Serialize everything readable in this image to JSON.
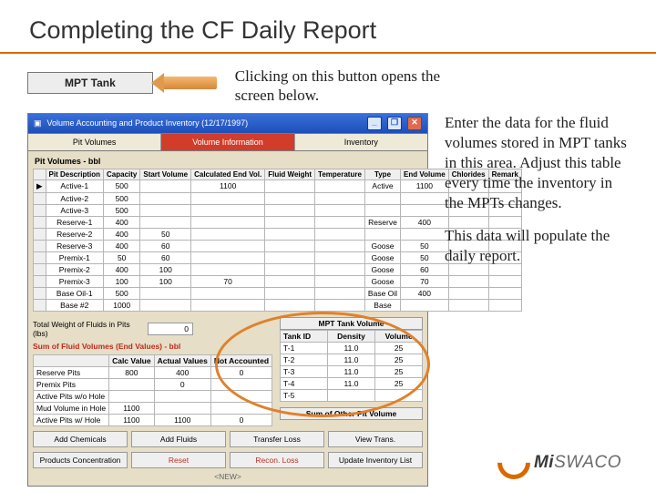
{
  "title": "Completing the CF Daily Report",
  "button": {
    "label": "MPT Tank"
  },
  "lead": "Clicking on this button opens the screen below.",
  "side": {
    "p1": "Enter the data for the fluid volumes stored in MPT tanks in this area. Adjust this table every time the inventory in the MPTs changes.",
    "p2": "This data will populate the daily report."
  },
  "window": {
    "title": "Volume Accounting and Product Inventory (12/17/1997)",
    "min": "_",
    "max": "❐",
    "close": "✕"
  },
  "tabs": {
    "a": "Pit Volumes",
    "b": "Volume Information",
    "c": "Inventory"
  },
  "section1": "Pit Volumes - bbl",
  "cols": {
    "c0": "",
    "c1": "Pit Description",
    "c2": "Capacity",
    "c3": "Start Volume",
    "c4": "Calculated End Vol.",
    "c5": "Fluid Weight",
    "c6": "Temperature",
    "c7": "Type",
    "c8": "End Volume",
    "c9": "Chlorides",
    "c10": "Remark"
  },
  "rows": [
    {
      "d": "Active-1",
      "cap": "500",
      "sv": "",
      "ce": "1100",
      "fw": "",
      "t": "",
      "ty": "Active",
      "ev": "1100",
      "cl": "",
      "rm": ""
    },
    {
      "d": "Active-2",
      "cap": "500",
      "sv": "",
      "ce": "",
      "fw": "",
      "t": "",
      "ty": "",
      "ev": "",
      "cl": "",
      "rm": ""
    },
    {
      "d": "Active-3",
      "cap": "500",
      "sv": "",
      "ce": "",
      "fw": "",
      "t": "",
      "ty": "",
      "ev": "",
      "cl": "",
      "rm": ""
    },
    {
      "d": "Reserve-1",
      "cap": "400",
      "sv": "",
      "ce": "",
      "fw": "",
      "t": "",
      "ty": "Reserve",
      "ev": "400",
      "cl": "",
      "rm": ""
    },
    {
      "d": "Reserve-2",
      "cap": "400",
      "sv": "50",
      "ce": "",
      "fw": "",
      "t": "",
      "ty": "",
      "ev": "",
      "cl": "",
      "rm": ""
    },
    {
      "d": "Reserve-3",
      "cap": "400",
      "sv": "60",
      "ce": "",
      "fw": "",
      "t": "",
      "ty": "Goose",
      "ev": "50",
      "cl": "",
      "rm": ""
    },
    {
      "d": "Premix-1",
      "cap": "50",
      "sv": "60",
      "ce": "",
      "fw": "",
      "t": "",
      "ty": "Goose",
      "ev": "50",
      "cl": "",
      "rm": ""
    },
    {
      "d": "Premix-2",
      "cap": "400",
      "sv": "100",
      "ce": "",
      "fw": "",
      "t": "",
      "ty": "Goose",
      "ev": "60",
      "cl": "",
      "rm": ""
    },
    {
      "d": "Premix-3",
      "cap": "100",
      "sv": "100",
      "ce": "70",
      "fw": "",
      "t": "",
      "ty": "Goose",
      "ev": "70",
      "cl": "",
      "rm": ""
    },
    {
      "d": "Base Oil-1",
      "cap": "500",
      "sv": "",
      "ce": "",
      "fw": "",
      "t": "",
      "ty": "Base Oil",
      "ev": "400",
      "cl": "",
      "rm": ""
    },
    {
      "d": "Base #2",
      "cap": "1000",
      "sv": "",
      "ce": "",
      "fw": "",
      "t": "",
      "ty": "Base",
      "ev": "",
      "cl": "",
      "rm": ""
    }
  ],
  "totalWeightLbl": "Total Weight of Fluids in Pits (lbs)",
  "totalWeightVal": "0",
  "sfvHeader": "Sum of Fluid Volumes (End Values) - bbl",
  "sfvCols": {
    "a": "Calc Value",
    "b": "Actual Values",
    "c": "Not Accounted"
  },
  "sfv": [
    {
      "l": "Reserve Pits",
      "a": "800",
      "b": "400",
      "c": "0"
    },
    {
      "l": "Premix Pits",
      "a": "",
      "b": "0",
      "c": ""
    },
    {
      "l": "Active Pits w/o Hole",
      "a": "",
      "b": "",
      "c": ""
    },
    {
      "l": "Mud Volume in Hole",
      "a": "1100",
      "b": "",
      "c": ""
    },
    {
      "l": "Active Pits w/ Hole",
      "a": "1100",
      "b": "1100",
      "c": "0"
    }
  ],
  "mptHeader": "MPT Tank Volume",
  "mptCols": {
    "a": "Tank ID",
    "b": "Density",
    "c": "Volume"
  },
  "mpt": [
    {
      "id": "T-1",
      "d": "11.0",
      "v": "25"
    },
    {
      "id": "T-2",
      "d": "11.0",
      "v": "25"
    },
    {
      "id": "T-3",
      "d": "11.0",
      "v": "25"
    },
    {
      "id": "T-4",
      "d": "11.0",
      "v": "25"
    },
    {
      "id": "T-5",
      "d": "",
      "v": ""
    }
  ],
  "sumOther": "Sum of Other Pit Volume",
  "btns1": {
    "a": "Add Chemicals",
    "b": "Add Fluids",
    "c": "Transfer Loss",
    "d": "View Trans."
  },
  "btns2": {
    "a": "Products Concentration",
    "b": "Reset",
    "c": "Recon. Loss",
    "d": "Update Inventory List"
  },
  "readonly": "<NEW>",
  "logo": {
    "a": "Mi",
    "b": "SWACO"
  }
}
